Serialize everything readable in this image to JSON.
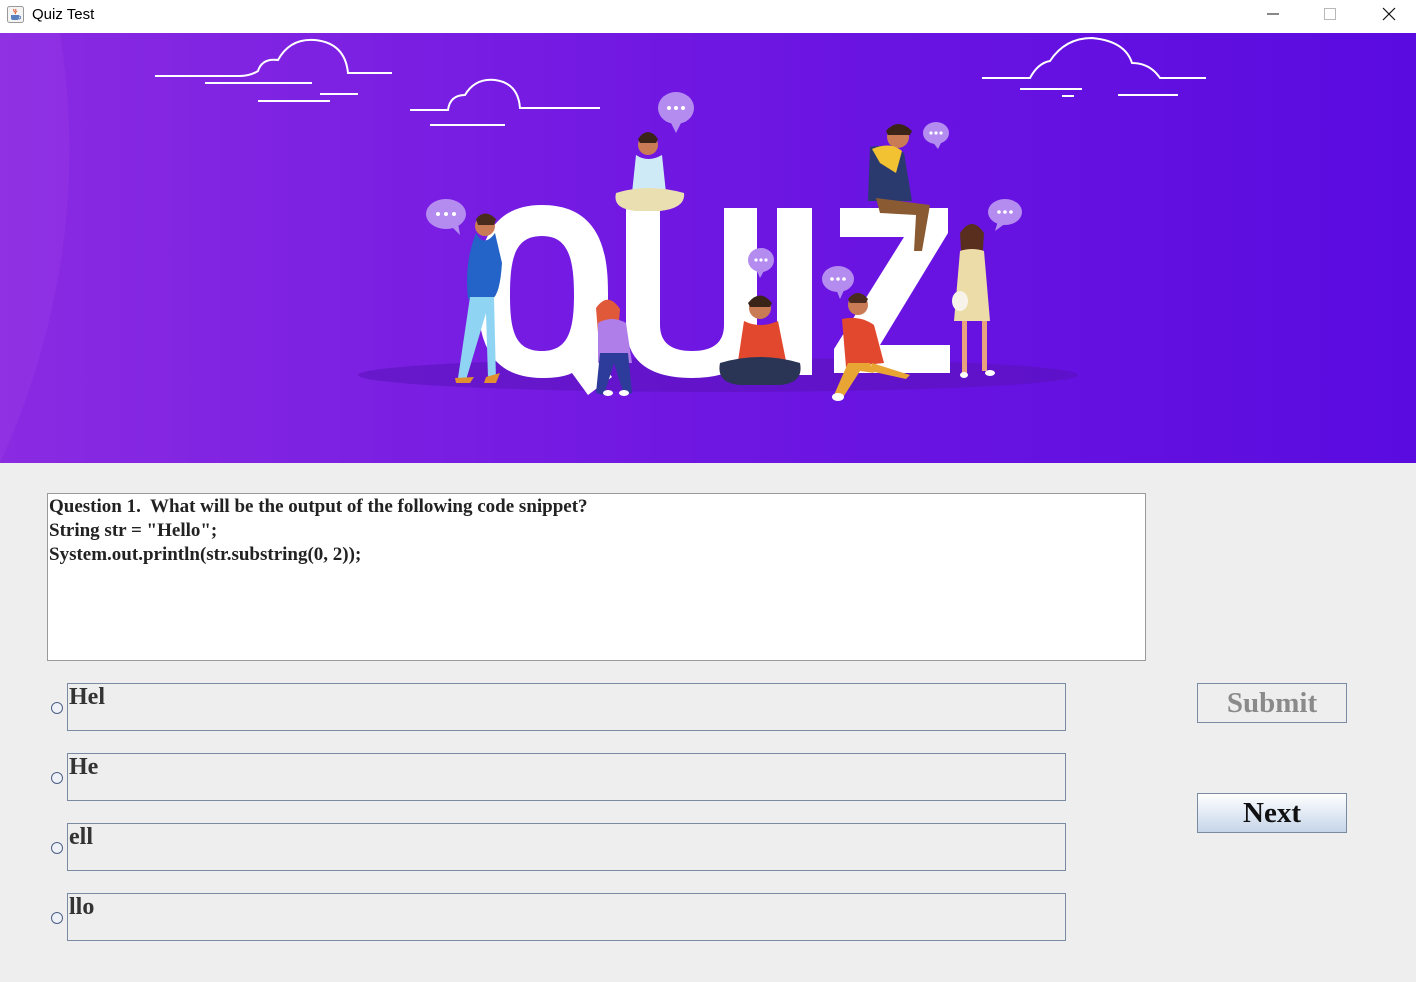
{
  "window": {
    "title": "Quiz Test",
    "app_icon": "java-cup-icon",
    "controls": [
      "minimize-icon",
      "maximize-icon",
      "close-icon"
    ]
  },
  "banner": {
    "wordmark": "QUIZ",
    "illustration": "people-with-phones-and-chat-bubbles",
    "colors": {
      "start": "#8a2be2",
      "end": "#5a0be0"
    }
  },
  "question": {
    "line1": "Question 1.  What will be the output of the following code snippet?",
    "line2": "String str = \"Hello\";",
    "line3": "System.out.println(str.substring(0, 2));"
  },
  "options": [
    {
      "label": "Hel",
      "selected": false
    },
    {
      "label": "He",
      "selected": false
    },
    {
      "label": "ell",
      "selected": false
    },
    {
      "label": "llo",
      "selected": false
    }
  ],
  "buttons": {
    "submit": {
      "label": "Submit",
      "enabled": false
    },
    "next": {
      "label": "Next",
      "enabled": true
    }
  }
}
